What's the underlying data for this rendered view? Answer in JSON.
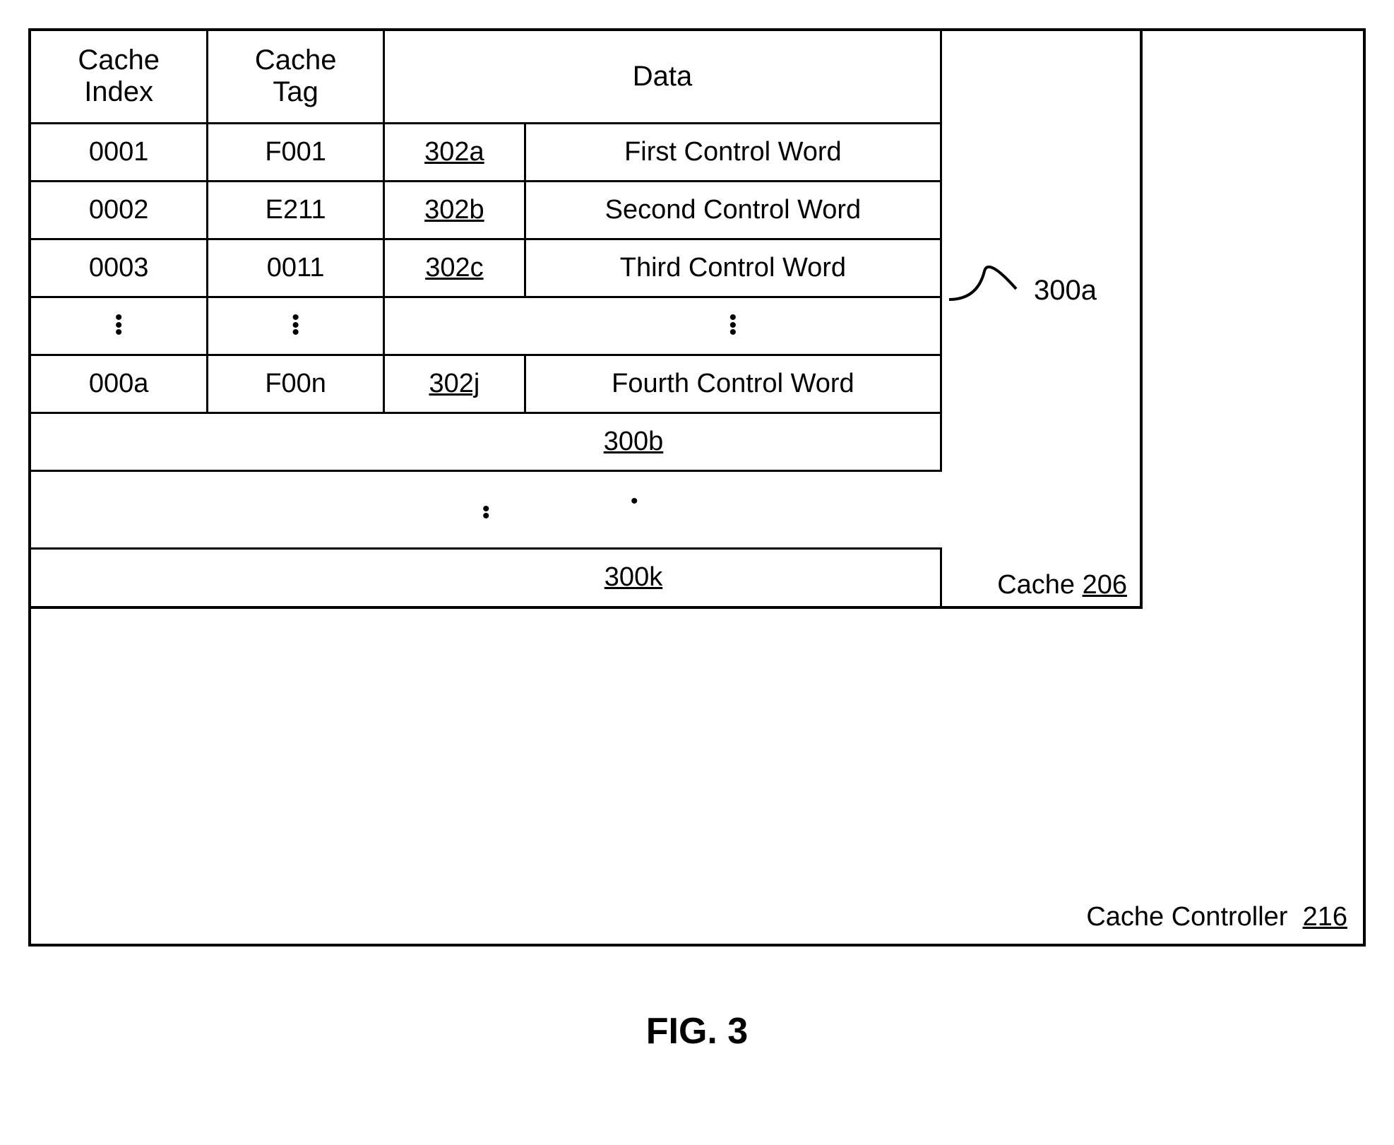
{
  "headers": {
    "col1": "Cache\nIndex",
    "col2": "Cache\nTag",
    "col3": "Data"
  },
  "rows": [
    {
      "index": "0001",
      "tag": "F001",
      "ref": "302a",
      "desc": "First Control Word"
    },
    {
      "index": "0002",
      "tag": "E211",
      "ref": "302b",
      "desc": "Second Control Word"
    },
    {
      "index": "0003",
      "tag": "0011",
      "ref": "302c",
      "desc": "Third Control Word"
    }
  ],
  "ellipsis_row": {
    "index": "⋮",
    "tag": "⋮",
    "desc": "⋮"
  },
  "last_row": {
    "index": "000a",
    "tag": "F00n",
    "ref": "302j",
    "desc": "Fourth Control Word"
  },
  "slabs": {
    "b": "300b",
    "k": "300k"
  },
  "callout": "300a",
  "cache_label": {
    "text": "Cache",
    "num": "206"
  },
  "controller_label": {
    "text": "Cache Controller",
    "num": "216"
  },
  "figure_caption": "FIG. 3"
}
